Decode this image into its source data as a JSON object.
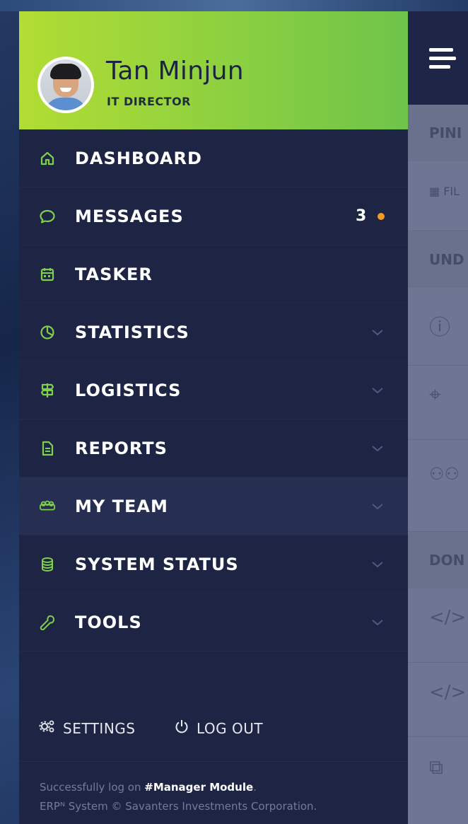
{
  "profile": {
    "name": "Tan Minjun",
    "role": "IT DIRECTOR"
  },
  "menu": [
    {
      "label": "DASHBOARD",
      "icon": "home-icon",
      "has_chevron": false
    },
    {
      "label": "MESSAGES",
      "icon": "chat-bubble-icon",
      "badge": "3",
      "has_chevron": false
    },
    {
      "label": "TASKER",
      "icon": "calendar-icon",
      "has_chevron": false
    },
    {
      "label": "STATISTICS",
      "icon": "pie-chart-icon",
      "has_chevron": true
    },
    {
      "label": "LOGISTICS",
      "icon": "signpost-icon",
      "has_chevron": true
    },
    {
      "label": "REPORTS",
      "icon": "document-icon",
      "has_chevron": true
    },
    {
      "label": "MY TEAM",
      "icon": "team-icon",
      "has_chevron": true,
      "active": true
    },
    {
      "label": "SYSTEM STATUS",
      "icon": "database-icon",
      "has_chevron": true
    },
    {
      "label": "TOOLS",
      "icon": "tool-icon",
      "has_chevron": true
    }
  ],
  "footer": {
    "settings_label": "SETTINGS",
    "logout_label": "LOG OUT",
    "status_prefix": "Successfully log on ",
    "status_module": "#Manager Module",
    "status_suffix": ".",
    "copyright": "ERPᴺ System © Savanters Investments Corporation."
  },
  "background_app": {
    "sections": [
      "PINI",
      "UND",
      "DON"
    ],
    "filter_label": "FIL"
  },
  "colors": {
    "accent_green": "#8fd13f",
    "drawer_bg": "#1e2444",
    "badge_dot": "#f39a23",
    "icon_green": "#7ed04a"
  }
}
